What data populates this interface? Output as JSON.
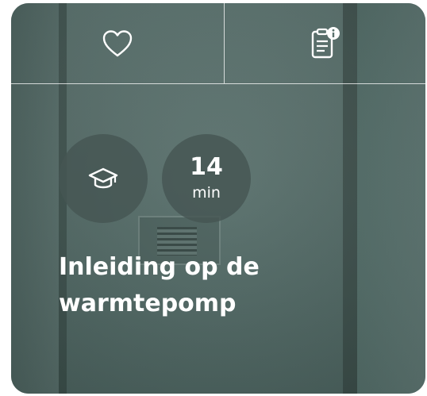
{
  "card": {
    "favorite_icon": "heart-icon",
    "info_icon": "clipboard-info-icon",
    "course_icon": "graduation-cap-icon",
    "duration_value": "14",
    "duration_unit": "min",
    "title": "Inleiding op de warmtepomp"
  },
  "colors": {
    "card_overlay": "#5a716d",
    "circle_fill": "#465653",
    "text": "#ffffff"
  }
}
